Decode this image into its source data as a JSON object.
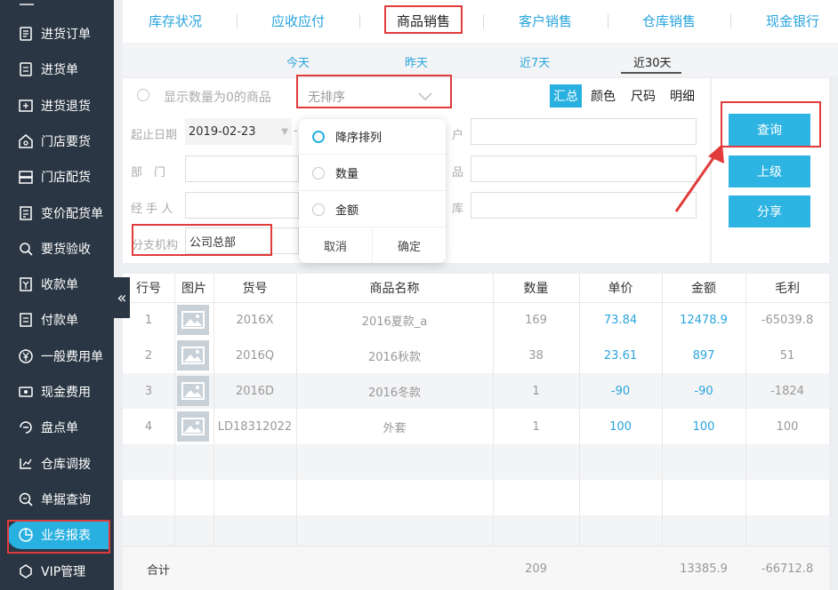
{
  "sidebar": {
    "items": [
      {
        "label": "进货订单",
        "icon": "cart-order-icon"
      },
      {
        "label": "进货单",
        "icon": "receipt-icon"
      },
      {
        "label": "进货退货",
        "icon": "return-icon"
      },
      {
        "label": "门店要货",
        "icon": "store-request-icon"
      },
      {
        "label": "门店配货",
        "icon": "store-delivery-icon"
      },
      {
        "label": "变价配货单",
        "icon": "price-change-icon"
      },
      {
        "label": "要货验收",
        "icon": "inspection-icon"
      },
      {
        "label": "收款单",
        "icon": "collection-icon"
      },
      {
        "label": "付款单",
        "icon": "payment-icon"
      },
      {
        "label": "一般费用单",
        "icon": "yen-icon"
      },
      {
        "label": "现金费用",
        "icon": "cash-icon"
      },
      {
        "label": "盘点单",
        "icon": "inventory-check-icon"
      },
      {
        "label": "仓库调拨",
        "icon": "transfer-icon"
      },
      {
        "label": "单据查询",
        "icon": "search-doc-icon"
      },
      {
        "label": "业务报表",
        "icon": "pie-chart-icon"
      },
      {
        "label": "VIP管理",
        "icon": "vip-icon"
      }
    ],
    "active_index": 14,
    "collapse_glyph": "«"
  },
  "top_tabs": [
    "库存状况",
    "应收应付",
    "商品销售",
    "客户销售",
    "仓库销售",
    "现金银行"
  ],
  "top_tab_selected": 2,
  "date_tabs": [
    "今天",
    "昨天",
    "近7天",
    "近30天"
  ],
  "date_tab_selected": 3,
  "filter": {
    "show_zero_label": "显示数量为0的商品",
    "sort_value": "无排序",
    "modes": [
      "汇总",
      "颜色",
      "尺码",
      "明细"
    ],
    "mode_selected": 0,
    "date_label": "起止日期",
    "date_start": "2019-02-23",
    "date_sep": "-",
    "dept_label": "部　门",
    "handler_label": "经 手 人",
    "branch_label": "分支机构",
    "branch_value": "公司总部",
    "customer_label_tail": "户",
    "product_label_tail": "品",
    "warehouse_label_tail": "库"
  },
  "sort_dropdown": {
    "options": [
      "降序排列",
      "数量",
      "金额"
    ],
    "selected": 0,
    "cancel": "取消",
    "confirm": "确定"
  },
  "buttons": {
    "query": "查询",
    "up": "上级",
    "share": "分享"
  },
  "table": {
    "headers": [
      "行号",
      "图片",
      "货号",
      "商品名称",
      "数量",
      "单价",
      "金额",
      "毛利"
    ],
    "rows": [
      {
        "no": "1",
        "code": "2016X",
        "name": "2016夏款_a",
        "qty": "169",
        "price": "73.84",
        "amount": "12478.9",
        "profit": "-65039.8"
      },
      {
        "no": "2",
        "code": "2016Q",
        "name": "2016秋款",
        "qty": "38",
        "price": "23.61",
        "amount": "897",
        "profit": "51"
      },
      {
        "no": "3",
        "code": "2016D",
        "name": "2016冬款",
        "qty": "1",
        "price": "-90",
        "amount": "-90",
        "profit": "-1824"
      },
      {
        "no": "4",
        "code": "LD18312022",
        "name": "外套",
        "qty": "1",
        "price": "100",
        "amount": "100",
        "profit": "100"
      }
    ],
    "total_label": "合计",
    "total_qty": "209",
    "total_amount": "13385.9",
    "total_profit": "-66712.8"
  },
  "colors": {
    "sidebar_bg": "#2a3643",
    "accent": "#27b0e0",
    "annotation_red": "#e23b3b"
  }
}
